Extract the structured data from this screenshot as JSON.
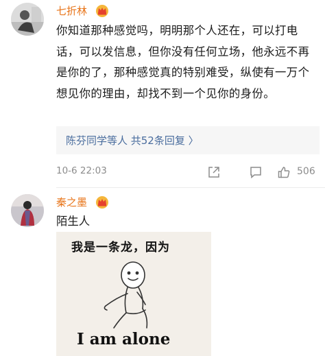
{
  "comment1": {
    "username": "七折林",
    "badge_icon": "crown-badge-icon",
    "text": "你知道那种感觉吗，明明那个人还在，可以打电话，可以发信息，但你没有任何立场，他永远不再是你的了，那种感觉真的特别难受，纵使有一万个想见你的理由，却找不到一个见你的身份。",
    "reply_summary": "陈芬同学等人 共52条回复 〉",
    "time": "10-6 22:03",
    "actions": {
      "share_icon": "share-icon",
      "comment_icon": "comment-icon",
      "like_icon": "thumbs-up-icon",
      "like_count": "506"
    }
  },
  "comment2": {
    "username": "秦之墨",
    "badge_icon": "crown-badge-icon",
    "text": "陌生人",
    "meme": {
      "top_text": "我是一条龙，因为",
      "bottom_text": "I am alone"
    }
  },
  "colors": {
    "username": "#e8751a",
    "link": "#4a6d9e",
    "meta": "#8c8c8c",
    "reply_bg": "#f6f6f6"
  }
}
